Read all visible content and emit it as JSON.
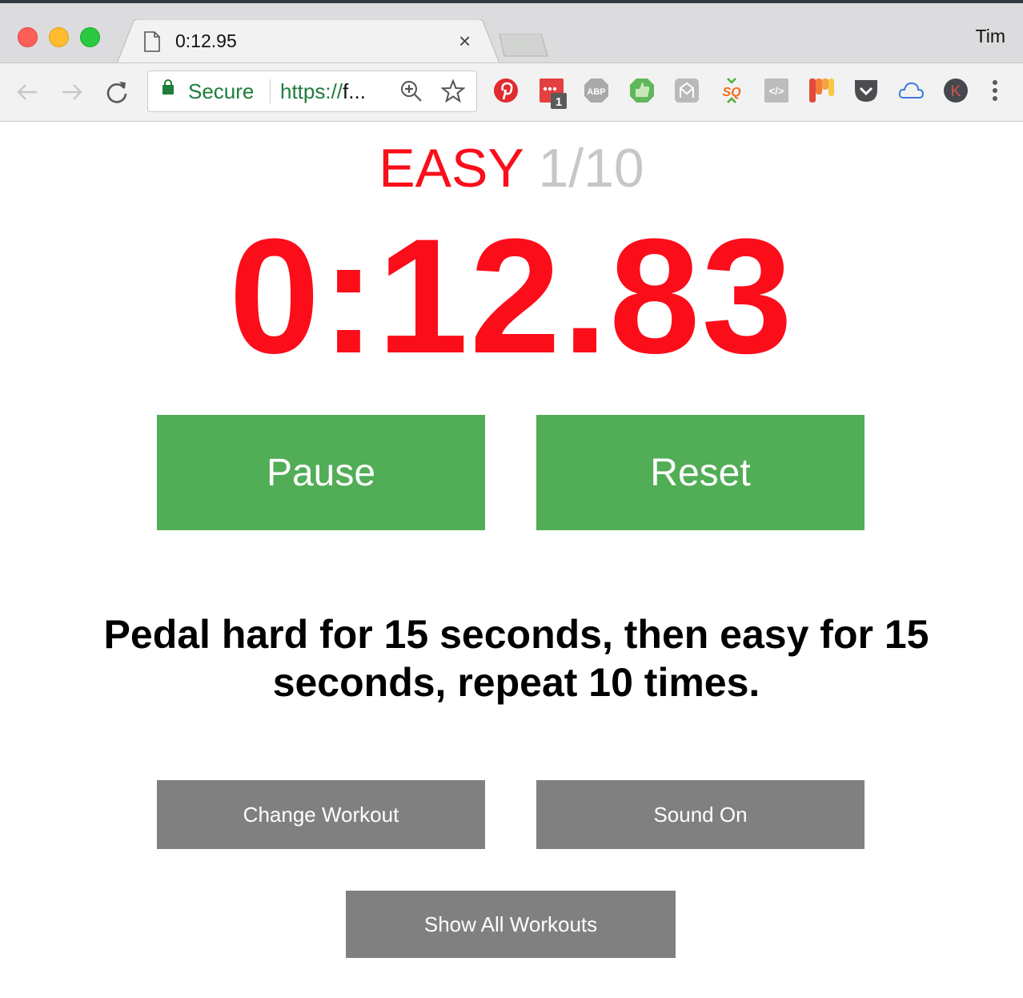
{
  "browser": {
    "tab": {
      "title": "0:12.95",
      "icon": "document-icon",
      "close_label": "×"
    },
    "profile_name": "Tim",
    "address_bar": {
      "security_label": "Secure",
      "url_scheme": "https://",
      "url_rest": "f..."
    },
    "extensions": [
      {
        "name": "pinterest-icon"
      },
      {
        "name": "todoist-icon",
        "badge": "1"
      },
      {
        "name": "adblock-plus-icon",
        "label": "ABP"
      },
      {
        "name": "thumbs-up-icon"
      },
      {
        "name": "gmail-extension-icon"
      },
      {
        "name": "sq-icon",
        "label": "SQ"
      },
      {
        "name": "code-view-icon",
        "label": "</>"
      },
      {
        "name": "paint-drip-icon"
      },
      {
        "name": "pocket-icon"
      },
      {
        "name": "cloud-icon"
      },
      {
        "name": "k-avatar-icon",
        "label": "K"
      },
      {
        "name": "more-menu-icon"
      }
    ]
  },
  "workout": {
    "phase_label": "EASY",
    "round": "1/10",
    "timer": "0:12.83",
    "description": "Pedal hard for 15 seconds, then easy for 15 seconds, repeat 10 times."
  },
  "buttons": {
    "pause": "Pause",
    "reset": "Reset",
    "change_workout": "Change Workout",
    "sound": "Sound On",
    "show_all": "Show All Workouts"
  },
  "colors": {
    "accent_red": "#fb0d1a",
    "button_green": "#51ad56",
    "button_gray": "#808080",
    "secure_green": "#1e7d3b"
  }
}
